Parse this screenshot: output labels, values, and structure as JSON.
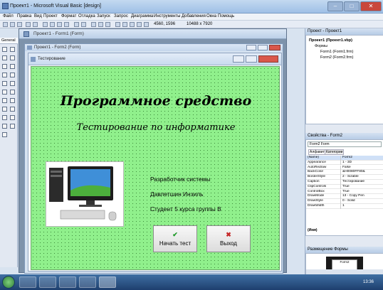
{
  "window": {
    "title": "Проект1 - Microsoft Visual Basic [design]"
  },
  "menu": [
    "Файл",
    "Правка",
    "Вид",
    "Проект",
    "Формат",
    "Отладка",
    "Запуск",
    "Запрос",
    "Диаграмма",
    "Инструменты",
    "Добавления",
    "Окна",
    "Помощь"
  ],
  "toolbar": {
    "position": "4560, 1596",
    "size": "10488 x 7920"
  },
  "toolbox": {
    "title": "General"
  },
  "mdi": {
    "form1_title": "Проект1 - Form1 (Form)",
    "form2_title": "Проект1 - Form2 (Form)",
    "form_caption": "Тестирование"
  },
  "form": {
    "heading": "Программное средство",
    "subheading": "Тестирование по информатике",
    "developer_label": "Разработчик системы",
    "developer_name": "Давлетшин Инзиль",
    "student": "Студент 5 курса группы В",
    "start_button": "Начать тест",
    "exit_button": "Выход",
    "start_icon": "check-icon",
    "exit_icon": "cross-icon"
  },
  "project_panel": {
    "title": "Проект - Проект1",
    "root": "Проект1 (Проект1.vbp)",
    "folder": "Формы",
    "items": [
      "Form1 (Form1.frm)",
      "Form2 (Form2.frm)"
    ]
  },
  "properties_panel": {
    "title": "Свойства - Form2",
    "object": "Form2  Form",
    "tabs": [
      "Алфавит",
      "Категории"
    ],
    "rows": [
      {
        "key": "(Name)",
        "value": "Form2"
      },
      {
        "key": "Appearance",
        "value": "1 - 3D"
      },
      {
        "key": "AutoRedraw",
        "value": "False"
      },
      {
        "key": "BackColor",
        "value": "&H0080FF80&"
      },
      {
        "key": "BorderStyle",
        "value": "2 - Sizable"
      },
      {
        "key": "Caption",
        "value": "Тестирование"
      },
      {
        "key": "ClipControls",
        "value": "True"
      },
      {
        "key": "ControlBox",
        "value": "True"
      },
      {
        "key": "DrawMode",
        "value": "13 - Copy Pen"
      },
      {
        "key": "DrawStyle",
        "value": "0 - Solid"
      },
      {
        "key": "DrawWidth",
        "value": "1"
      }
    ],
    "footer": "(Имя)"
  },
  "layout_panel": {
    "title": "Размещение Формы",
    "preview_label": "Form2"
  },
  "taskbar": {
    "clock": "13:36"
  },
  "colors": {
    "form_bg": "#90f08c",
    "titlebar": "#b7cce6",
    "taskbar": "#1e3f6e"
  }
}
